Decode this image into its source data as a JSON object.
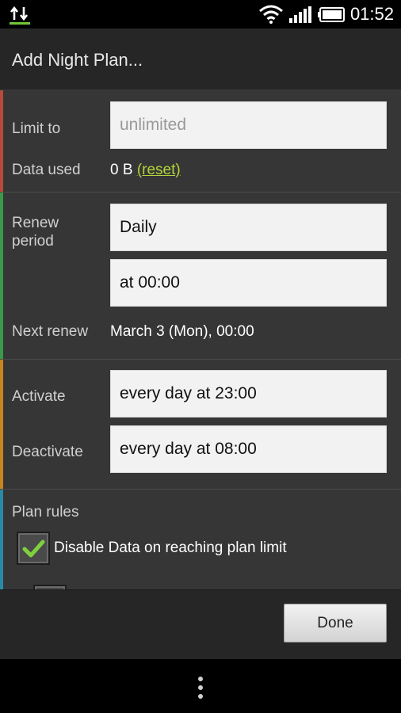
{
  "status_bar": {
    "time": "01:52",
    "app_icon": "data-transfer-icon",
    "icons": [
      "wifi-icon",
      "signal-icon",
      "battery-icon"
    ]
  },
  "title": "Add Night Plan...",
  "limit_section": {
    "limit_label": "Limit to",
    "limit_placeholder": "unlimited",
    "data_used_label": "Data used",
    "data_used_value": "0 B",
    "reset_label": "(reset)",
    "stripe_color": "#b84a3a"
  },
  "renew_section": {
    "renew_label": "Renew period",
    "renew_value": "Daily",
    "time_value": "at 00:00",
    "next_renew_label": "Next renew",
    "next_renew_value": "March 3 (Mon), 00:00",
    "stripe_color": "#3a9a4a"
  },
  "activate_section": {
    "activate_label": "Activate",
    "activate_value": "every day at 23:00",
    "deactivate_label": "Deactivate",
    "deactivate_value": "every day at 08:00",
    "stripe_color": "#c8841e"
  },
  "rules_section": {
    "rules_label": "Plan rules",
    "rule_1_label": "Disable Data on reaching plan limit",
    "rule_1_checked": true,
    "stripe_color": "#2a8aa6"
  },
  "done_label": "Done"
}
